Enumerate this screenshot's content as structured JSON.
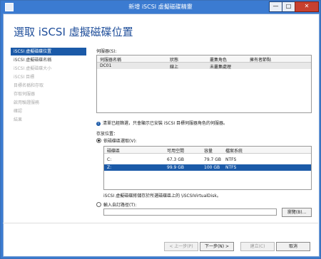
{
  "window": {
    "title": "新增 iSCSI 虛擬磁碟精靈",
    "min_glyph": "—",
    "max_glyph": "□",
    "close_glyph": "✕"
  },
  "heading": "選取 iSCSI 虛擬磁碟位置",
  "nav": {
    "items": [
      {
        "label": "iSCSI 虛擬磁碟位置",
        "state": "active"
      },
      {
        "label": "iSCSI 虛擬磁碟名稱",
        "state": "normal"
      },
      {
        "label": "iSCSI 虛擬磁碟大小",
        "state": "disabled"
      },
      {
        "label": "iSCSI 目標",
        "state": "disabled"
      },
      {
        "label": "目標名稱和存取",
        "state": "disabled"
      },
      {
        "label": "存取伺服器",
        "state": "disabled"
      },
      {
        "label": "啟用驗證服務",
        "state": "disabled"
      },
      {
        "label": "確認",
        "state": "disabled"
      },
      {
        "label": "結果",
        "state": "disabled"
      }
    ]
  },
  "server_section": {
    "label": "伺服器(S):",
    "columns": [
      "伺服器名稱",
      "狀態",
      "叢集角色",
      "擁有者節點"
    ],
    "rows": [
      [
        "DC01",
        "線上",
        "未叢集處理",
        ""
      ]
    ],
    "info_text": "清單已經篩選，只會顯示已安裝 iSCSI 目標伺服器角色的伺服器。"
  },
  "storage": {
    "label": "存放位置：",
    "by_volume_label": "依磁碟區選取(V):",
    "columns": [
      "磁碟區",
      "可用空間",
      "容量",
      "檔案系統"
    ],
    "rows": [
      [
        "C:",
        "67.3 GB",
        "79.7 GB",
        "NTFS"
      ],
      [
        "Z:",
        "99.9 GB",
        "100 GB",
        "NTFS"
      ]
    ],
    "note": "iSCSI 虛擬磁碟將儲存於所選磁碟區上的 \\iSCSIVirtualDisk。",
    "custom_path_label": "輸入自訂路徑(T):",
    "custom_path_value": "",
    "browse_label": "瀏覽(B)..."
  },
  "footer": {
    "prev": "< 上一步(P)",
    "next": "下一步(N) >",
    "create": "建立(C)",
    "cancel": "取消"
  }
}
